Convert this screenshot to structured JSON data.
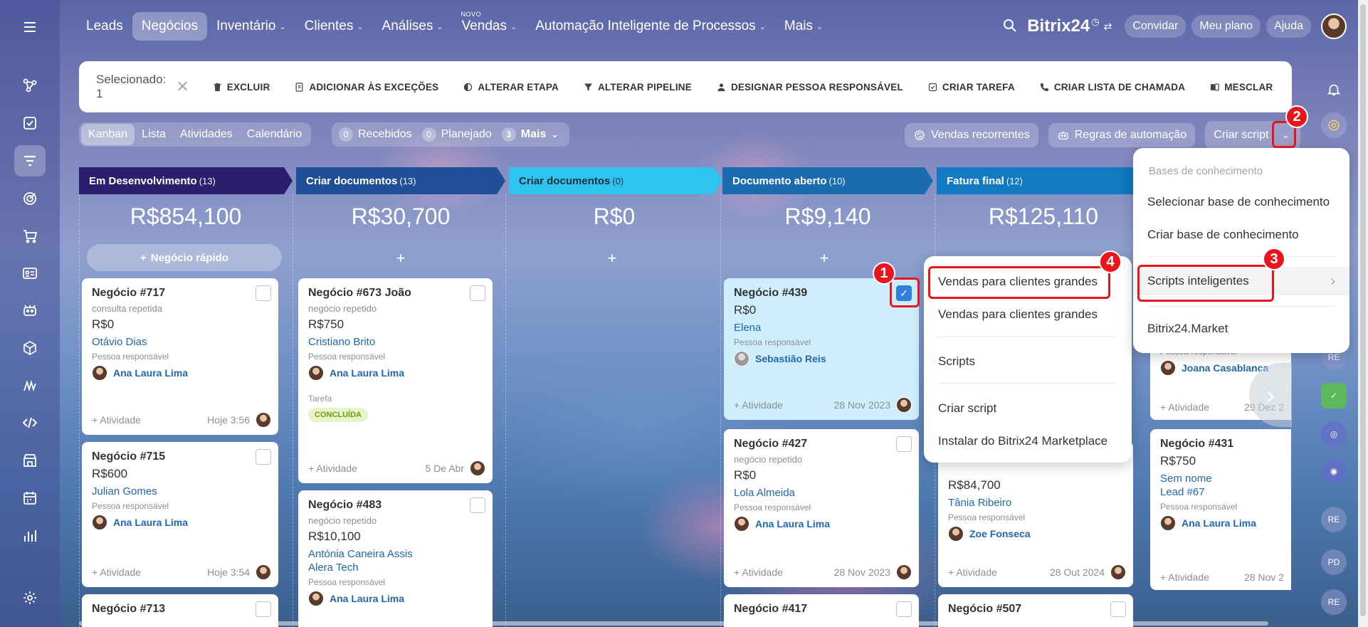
{
  "nav": {
    "items": [
      "Leads",
      "Negócios",
      "Inventário",
      "Clientes",
      "Análises",
      "Vendas",
      "Automação Inteligente de Processos",
      "Mais"
    ],
    "new_badge": "NOVO",
    "brand": "Bitrix24",
    "invite": "Convidar",
    "plan": "Meu plano",
    "help": "Ajuda"
  },
  "toolbar": {
    "selected": "Selecionado: 1",
    "actions": [
      "EXCLUIR",
      "ADICIONAR ÀS EXCEÇÕES",
      "ALTERAR ETAPA",
      "ALTERAR PIPELINE",
      "DESIGNAR PESSOA RESPONSÁVEL",
      "CRIAR TAREFA",
      "CRIAR LISTA DE CHAMADA",
      "MESCLAR"
    ]
  },
  "views": [
    "Kanban",
    "Lista",
    "Atividades",
    "Calendário"
  ],
  "counters": [
    {
      "n": "0",
      "label": "Recebidos"
    },
    {
      "n": "0",
      "label": "Planejado"
    },
    {
      "n": "3",
      "label": "Mais"
    }
  ],
  "tools": {
    "recurring": "Vendas recorrentes",
    "automation": "Regras de automação",
    "create_script": "Criar script"
  },
  "columns": [
    {
      "name": "Em Desenvolvimento",
      "count": "(13)",
      "sum": "R$854,100",
      "color": "#2b1e6e"
    },
    {
      "name": "Criar documentos",
      "count": "(13)",
      "sum": "R$30,700",
      "color": "#1f4f96"
    },
    {
      "name": "Criar documentos",
      "count": "(0)",
      "sum": "R$0",
      "color": "#2fc4ee"
    },
    {
      "name": "Documento aberto",
      "count": "(10)",
      "sum": "R$9,140",
      "color": "#1b6bb0"
    },
    {
      "name": "Fatura final",
      "count": "(12)",
      "sum": "R$125,110",
      "color": "#1379c0"
    }
  ],
  "quick_add": "Negócio rápido",
  "resp_label": "Pessoa responsável",
  "activity_label": "+ Atividade",
  "cards": {
    "c717": {
      "title": "Negócio #717",
      "sub": "consulta repetida",
      "amt": "R$0",
      "contact": "Otávio Dias",
      "resp": "Ana Laura Lima",
      "date": "Hoje 3:56"
    },
    "c715": {
      "title": "Negócio #715",
      "amt": "R$600",
      "contact": "Julian Gomes",
      "resp": "Ana Laura Lima",
      "date": "Hoje 3:54"
    },
    "c713": {
      "title": "Negócio #713"
    },
    "c673": {
      "title": "Negócio #673 João",
      "sub": "negócio repetido",
      "amt": "R$750",
      "contact": "Cristiano Brito",
      "resp": "Ana Laura Lima",
      "task": "Tarefa",
      "badge": "CONCLUÍDA",
      "date": "5 De Abr"
    },
    "c483": {
      "title": "Negócio #483",
      "sub": "negócio repetido",
      "amt": "R$10,100",
      "contact": "Antónia Caneira Assis",
      "contact2": "Alera Tech",
      "resp": "Ana Laura Lima"
    },
    "c439": {
      "title": "Negócio #439",
      "amt": "R$0",
      "contact": "Elena",
      "resp": "Sebastião Reis",
      "date": "28 Nov 2023"
    },
    "c427": {
      "title": "Negócio #427",
      "sub": "negócio repetido",
      "amt": "R$0",
      "contact": "Lola Almeida",
      "resp": "Ana Laura Lima",
      "date": "28 Nov 2023"
    },
    "c417": {
      "title": "Negócio #417"
    },
    "cff": {
      "amt": "R$84,700",
      "contact": "Tânia Ribeiro",
      "resp": "Zoe Fonseca",
      "date": "28 Out 2024"
    },
    "c507": {
      "title": "Negócio #507"
    },
    "c_joana": {
      "role": "Pessoa responsável",
      "resp": "Joana Casablanca",
      "date": "29 Dez 2"
    },
    "c431": {
      "title": "Negócio #431",
      "amt": "R$750",
      "contact": "Sem nome",
      "contact2": "Lead #67",
      "resp": "Ana Laura Lima",
      "date": "28 Nov 2"
    }
  },
  "script_menu": {
    "items": [
      "Vendas para clientes grandes",
      "Vendas para clientes grandes",
      "Scripts",
      "Criar script",
      "Instalar do Bitrix24 Marketplace"
    ]
  },
  "main_menu": {
    "label": "Bases de conhecimento",
    "items": [
      "Selecionar base de conhecimento",
      "Criar base de conhecimento",
      "Scripts inteligentes",
      "Bitrix24.Market"
    ]
  },
  "markers": [
    "1",
    "2",
    "3",
    "4"
  ],
  "right_avatars": [
    "RE",
    "PD",
    "RE"
  ],
  "colors": {
    "highlight": "#e8151b",
    "link": "#2067b0",
    "checkbox": "#2f7fe0"
  }
}
